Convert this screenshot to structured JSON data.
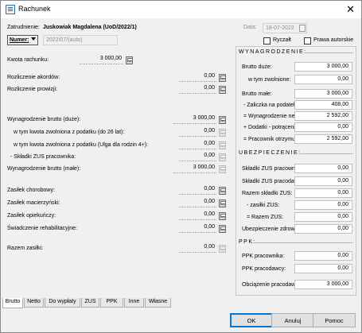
{
  "window": {
    "title": "Rachunek",
    "close": "✕"
  },
  "header": {
    "zatrudnienie_label": "Zatrudnienie:",
    "zatrudnienie_value": "Juskowiak Magdalena  (UoD/2022/1)",
    "data_label": "Data:",
    "data_value": "18-07-2022",
    "numer_label": "Numer:",
    "numer_value": "2022/07/(auto)",
    "ryczalt_label": "Ryczałt",
    "prawa_label": "Prawa autorskie"
  },
  "left": {
    "kwota_label": "Kwota rachunku:",
    "kwota_value": "3 000,00",
    "akordow_label": "Rozliczenie akordów:",
    "akordow_value": "0,00",
    "prowizji_label": "Rozliczenie prowizji:",
    "prowizji_value": "0,00",
    "wyn_brutto_duze_label": "Wynagrodzenie brutto (duże):",
    "wyn_brutto_duze_value": "3 000,00",
    "zwolniona26_label": "w tym kwota zwolniona z podatku (do 26 lat):",
    "zwolniona26_value": "0,00",
    "zwolniona4_label": "w tym kwota zwolniona z podatku (Ulga dla rodzin 4+):",
    "zwolniona4_value": "0,00",
    "skladki_label": "- Składki ZUS pracownika:",
    "skladki_value": "0,00",
    "wyn_brutto_male_label": "Wynagrodzenie brutto (małe):",
    "wyn_brutto_male_value": "3 000,00",
    "chorobowy_label": "Zasiłek chorobowy:",
    "chorobowy_value": "0,00",
    "macierzynski_label": "Zasiłek macierzyński:",
    "macierzynski_value": "0,00",
    "opiekunczy_label": "Zasiłek opiekuńczy:",
    "opiekunczy_value": "0,00",
    "rehab_label": "Świadczenie rehabilitacyjne:",
    "rehab_value": "0,00",
    "razem_label": "Razem zasiłki:",
    "razem_value": "0,00"
  },
  "right": {
    "wyn_title": "WYNAGRODZENIE:",
    "brutto_duze_label": "Brutto duże:",
    "brutto_duze_value": "3 000,00",
    "zwolnione_label": "w tym zwolnione:",
    "zwolnione_value": "0,00",
    "brutto_male_label": "Brutto małe:",
    "brutto_male_value": "3 000,00",
    "zaliczka_label": "- Zaliczka na podatek:",
    "zaliczka_value": "408,00",
    "netto_label": "= Wynagrodzenie netto:",
    "netto_value": "2 592,00",
    "dodatki_label": "+ Dodatki - potrącenie:",
    "dodatki_value": "0,00",
    "otrzymuje_label": "= Pracownik otrzymuje:",
    "otrzymuje_value": "2 592,00",
    "ubezp_title": "UBEZPIECZENIE:",
    "zus_prac_label": "Składki ZUS pracownika:",
    "zus_prac_value": "0,00",
    "zus_pracod_label": "Składki ZUS pracodawcy:",
    "zus_pracod_value": "0,00",
    "razem_zus_label": "Razem składki ZUS:",
    "razem_zus_value": "0,00",
    "zasilki_zus_label": "- zasiłki ZUS:",
    "zasilki_zus_value": "0,00",
    "eq_razem_label": "= Razem ZUS:",
    "eq_razem_value": "0,00",
    "zdrowotne_label": "Ubezpieczenie zdrowotne:",
    "zdrowotne_value": "0,00",
    "ppk_title": "PPK:",
    "ppk_prac_label": "PPK pracownika:",
    "ppk_prac_value": "0,00",
    "ppk_pracod_label": "PPK pracodawcy:",
    "ppk_pracod_value": "0,00",
    "obciazenie_label": "Obciążenie pracodawcy:",
    "obciazenie_value": "3 000,00"
  },
  "tabs": [
    "Brutto",
    "Netto",
    "Do wypłaty",
    "ZUS",
    "PPK",
    "Inne",
    "Własne"
  ],
  "buttons": {
    "ok": "OK",
    "anuluj": "Anuluj",
    "pomoc": "Pomoc"
  }
}
